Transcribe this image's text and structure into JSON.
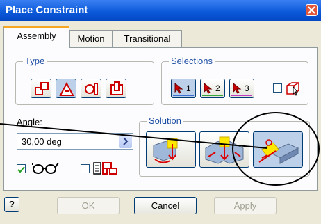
{
  "window": {
    "title": "Place Constraint"
  },
  "tabs": [
    {
      "label": "Assembly",
      "active": true
    },
    {
      "label": "Motion",
      "active": false
    },
    {
      "label": "Transitional",
      "active": false
    }
  ],
  "type_group": {
    "label": "Type",
    "buttons": [
      {
        "icon": "mate-icon",
        "pressed": false
      },
      {
        "icon": "angle-icon",
        "pressed": true
      },
      {
        "icon": "tangent-icon",
        "pressed": false
      },
      {
        "icon": "insert-icon",
        "pressed": false
      }
    ]
  },
  "selections_group": {
    "label": "Selections",
    "buttons": [
      {
        "number": "1",
        "color": "#3c6fd0",
        "pressed": true
      },
      {
        "number": "2",
        "color": "#35a83a",
        "pressed": false
      },
      {
        "number": "3",
        "color": "#c03cc0",
        "pressed": false
      }
    ],
    "pick_part_first_checked": false
  },
  "angle": {
    "label": "Angle:",
    "value": "30,00 deg"
  },
  "preview_checked": true,
  "predict_offset_checked": false,
  "solution_group": {
    "label": "Solution",
    "buttons": [
      {
        "icon": "directed-angle-icon",
        "pressed": false
      },
      {
        "icon": "undirected-angle-icon",
        "pressed": false
      },
      {
        "icon": "explicit-reference-vector-icon",
        "pressed": true
      }
    ]
  },
  "buttons": {
    "help": "?",
    "ok": "OK",
    "cancel": "Cancel",
    "apply": "Apply"
  },
  "colors": {
    "title_bar": "#0a58d8",
    "group_label": "#1d4ea3",
    "annotation": "#000000"
  }
}
